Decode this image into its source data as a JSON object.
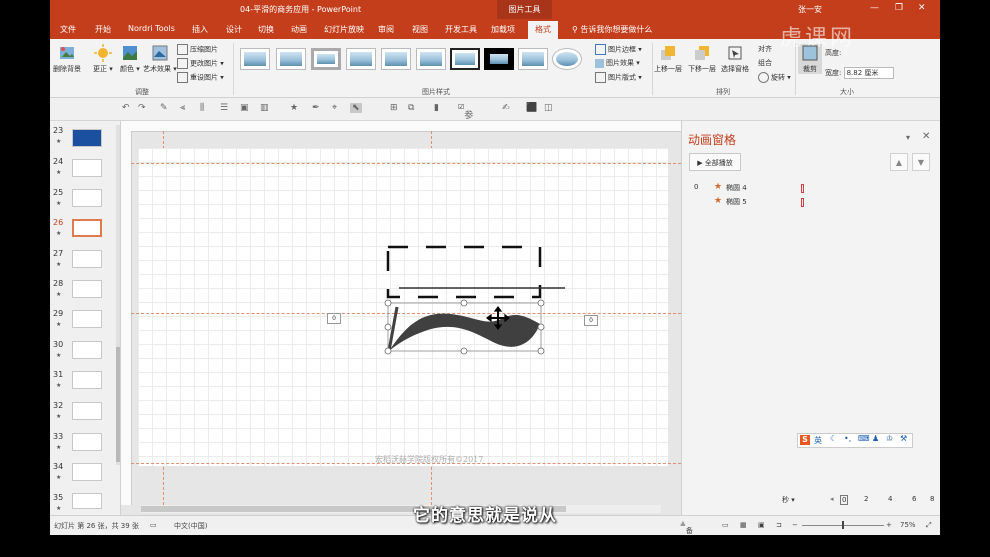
{
  "window": {
    "title": "04-平滑的商务应用 - PowerPoint",
    "context_tab_group": "图片工具",
    "user": "张一安",
    "watermark": "虎课网"
  },
  "tabs": [
    "文件",
    "开始",
    "Nordri Tools",
    "插入",
    "设计",
    "切换",
    "动画",
    "幻灯片放映",
    "审阅",
    "视图",
    "开发工具",
    "加载项",
    "格式"
  ],
  "tell_me": "告诉我你想要做什么",
  "ribbon": {
    "adjust": {
      "remove_bg": "删除背景",
      "correct": "更正",
      "color": "颜色",
      "artistic": "艺术效果",
      "compress": "压缩图片",
      "change": "更改图片",
      "reset": "重设图片",
      "group": "调整"
    },
    "styles": {
      "border": "图片边框",
      "effects": "图片效果",
      "layout": "图片版式",
      "group": "图片样式"
    },
    "arrange": {
      "forward": "上移一层",
      "backward": "下移一层",
      "selection_pane": "选择窗格",
      "rotate": "旋转",
      "align": "对齐",
      "group_btn": "组合",
      "group": "排列"
    },
    "size": {
      "crop": "裁剪",
      "height_label": "高度:",
      "width_label": "宽度:",
      "width_value": "8.82 厘米",
      "group": "大小"
    }
  },
  "qat": {
    "guides": "参考线"
  },
  "slides": [
    {
      "num": "23",
      "star": "★"
    },
    {
      "num": "24",
      "star": "★"
    },
    {
      "num": "25",
      "star": "★"
    },
    {
      "num": "26",
      "star": "★"
    },
    {
      "num": "27",
      "star": "★"
    },
    {
      "num": "28",
      "star": "★"
    },
    {
      "num": "29",
      "star": "★"
    },
    {
      "num": "30",
      "star": "★"
    },
    {
      "num": "31",
      "star": "★"
    },
    {
      "num": "32",
      "star": "★"
    },
    {
      "num": "33",
      "star": "★"
    },
    {
      "num": "34",
      "star": "★"
    },
    {
      "num": "35",
      "star": "★"
    }
  ],
  "canvas": {
    "footer": "宏稻沃赫学院版权所有©2017",
    "tag_left": "0",
    "tag_right": "0"
  },
  "animation_pane": {
    "title": "动画窗格",
    "play_all": "全部播放",
    "items": [
      {
        "index": "0",
        "name": "椭圆 4"
      },
      {
        "name": "椭圆 5"
      }
    ],
    "time_unit": "秒",
    "timeline": [
      "0",
      "2",
      "4",
      "6",
      "8"
    ]
  },
  "status": {
    "slide_info": "幻灯片 第 26 张，共 39 张",
    "language": "中文(中国)",
    "notes": "备注",
    "zoom": "75%"
  },
  "ime": {
    "label": "英"
  },
  "subtitle": "它的意思就是说从"
}
